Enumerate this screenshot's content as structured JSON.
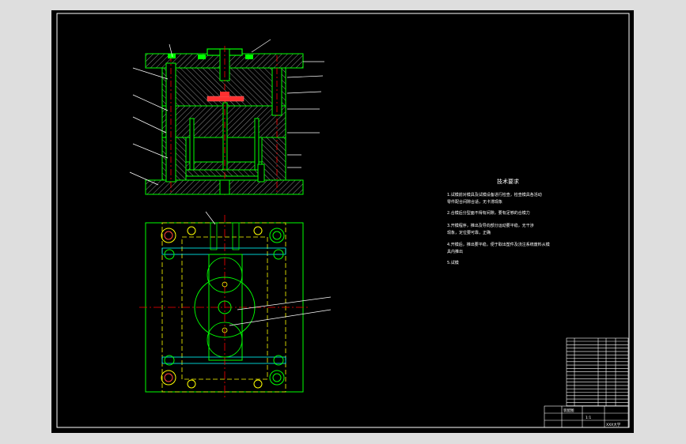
{
  "drawing": {
    "tech_requirements": {
      "heading": "技术要求",
      "items": [
        "1.试模前对模具及试模设备进行检查，检查模具各活动",
        "零件配合间隙合适，无卡滞现象",
        "2.合模后分型面不得有间隙，要有足够的合模力",
        "3.开模程序，推出及导向部分运动要平稳，无干涉",
        "现象，定位要可靠，正确",
        "4.开模后，推出要平稳，便于取出塑件及浇注系统废料从模",
        "具内推出",
        "5.试模"
      ]
    },
    "title_block": {
      "part_name_label": "装配图",
      "scale_label": "1:1",
      "school_label": "XXX大学"
    },
    "colors": {
      "background": "#000000",
      "frame": "#ffffff",
      "outline": "#00ff00",
      "center_line": "#ff0000",
      "hidden": "#ffff00",
      "hatch": "#808080",
      "leader": "#ffffff",
      "cyan": "#00ffff",
      "page": "#dedede"
    }
  }
}
